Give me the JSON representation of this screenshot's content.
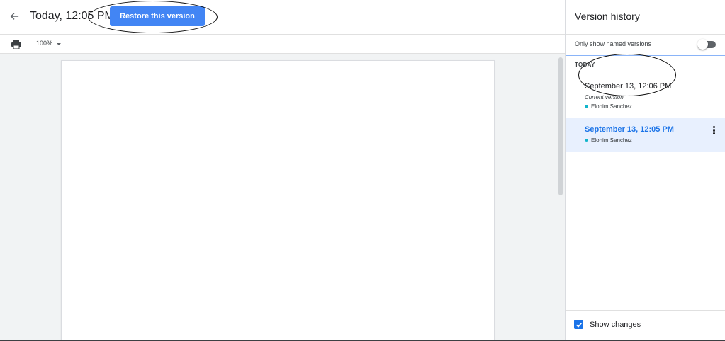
{
  "header": {
    "back_icon": "arrow-left-icon",
    "version_title": "Today, 12:05 PM",
    "restore_label": "Restore this version"
  },
  "toolbar": {
    "print_icon": "print-icon",
    "zoom_value": "100%"
  },
  "panel": {
    "title": "Version history",
    "named_only_label": "Only show named versions",
    "named_only_enabled": false,
    "section_label": "TODAY",
    "versions": [
      {
        "date": "September 13, 12:06 PM",
        "note": "Current version",
        "author": "Elohim Sanchez",
        "selected": false
      },
      {
        "date": "September 13, 12:05 PM",
        "author": "Elohim Sanchez",
        "selected": true
      }
    ],
    "show_changes_label": "Show changes",
    "show_changes_checked": true
  },
  "colors": {
    "accent": "#4285f4",
    "selected_bg": "#e8f0fe",
    "selected_text": "#1a73e8",
    "author_dot": "#12b5cb"
  }
}
